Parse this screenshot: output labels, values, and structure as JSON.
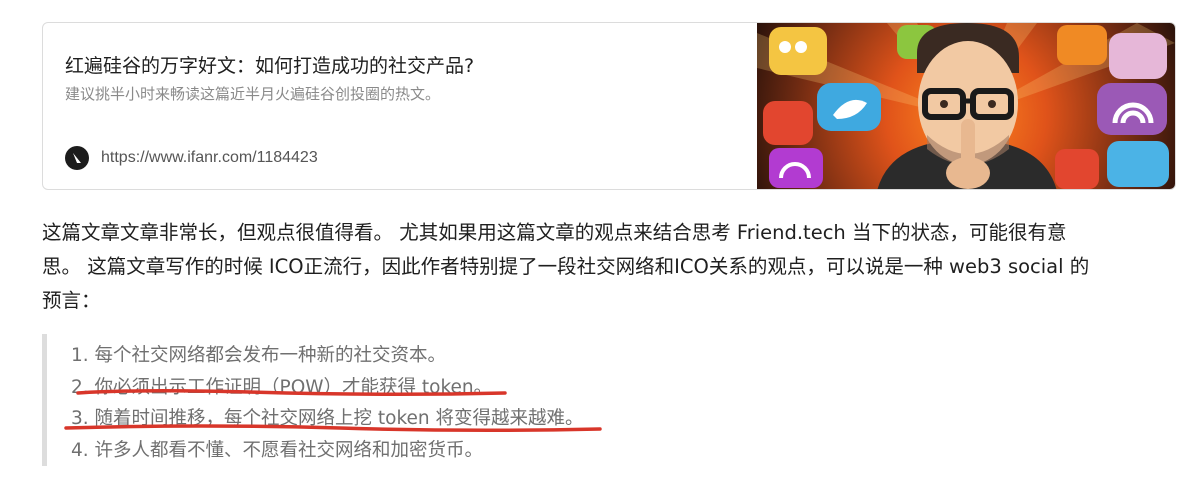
{
  "link_card": {
    "title": "红遍硅谷的万字好文：如何打造成功的社交产品?",
    "description": "建议挑半小时来畅读这篇近半月火遍硅谷创投圈的热文。",
    "url": "https://www.ifanr.com/1184423",
    "site_icon": "ifanr-logo-icon",
    "thumbnail": "man-with-finger-on-lips-and-social-media-icons-illustration"
  },
  "article": {
    "paragraph_lines": [
      "这篇文章文章非常长，但观点很值得看。 尤其如果用这篇文章的观点来结合思考 Friend.tech 当下的状态，可能很有意",
      "思。 这篇文章写作的时候 ICO正流行，因此作者特别提了一段社交网络和ICO关系的观点，可以说是一种 web3 social 的",
      "预言："
    ],
    "quote_items": [
      "1. 每个社交网络都会发布一种新的社交资本。",
      "2. 你必须出示工作证明（POW）才能获得 token。",
      "3. 随着时间推移，每个社交网络上挖 token 将变得越来越难。",
      "4. 许多人都看不懂、不愿看社交网络和加密货币。"
    ],
    "highlight_color": "#d8362a"
  }
}
